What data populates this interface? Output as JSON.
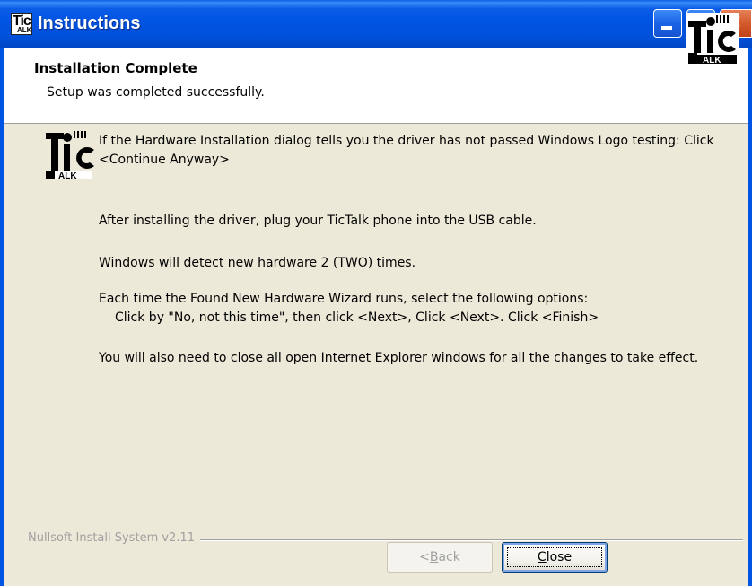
{
  "window": {
    "title": "Instructions",
    "app_icon": "tictalk-logo-icon",
    "controls": {
      "minimize": "minimize-icon",
      "maximize": "maximize-icon",
      "close": "close-icon"
    }
  },
  "header": {
    "title": "Installation Complete",
    "subtitle": "Setup was completed successfully.",
    "logo": "tictalk-logo"
  },
  "content": {
    "logo": "tictalk-logo",
    "paragraphs": [
      "If the Hardware Installation dialog tells you the driver has not passed Windows Logo testing: Click <Continue Anyway>",
      "After installing the driver, plug your TicTalk phone into the USB cable.",
      "Windows will detect new hardware 2 (TWO) times.",
      "Each time the Found New Hardware Wizard runs, select the following options:",
      "Click by \"No, not this time\", then click <Next>,  Click <Next>.  Click <Finish>",
      "You will also need to close all open Internet Explorer windows for all the changes to take effect."
    ]
  },
  "footer": {
    "branding": "Nullsoft Install System v2.11",
    "back_button": {
      "prefix": "< ",
      "accel": "B",
      "rest": "ack",
      "enabled": false
    },
    "close_button": {
      "accel": "C",
      "rest": "lose",
      "enabled": true
    }
  },
  "colors": {
    "titlebar": "#0054e3",
    "dialog_bg": "#ece9d8",
    "header_bg": "#ffffff",
    "disabled_text": "#a0a0a0"
  }
}
